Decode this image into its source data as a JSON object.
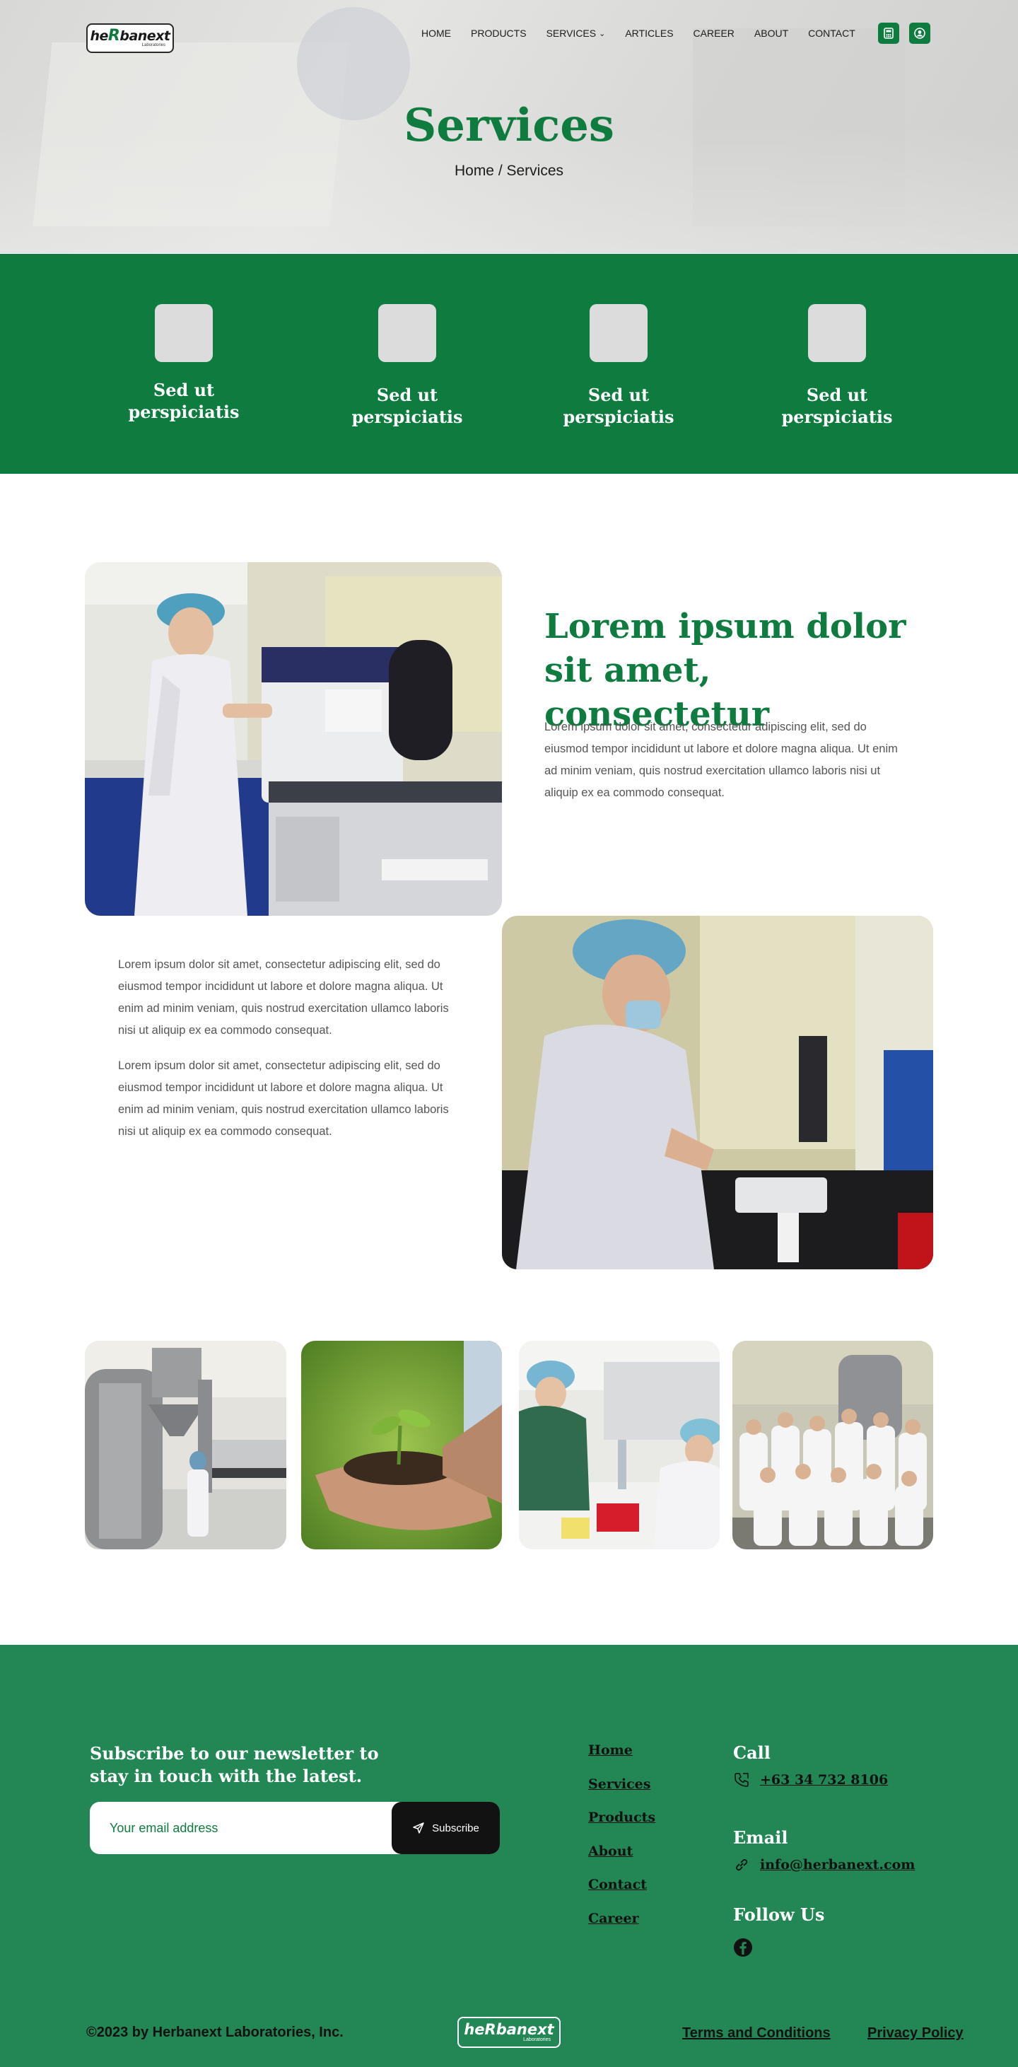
{
  "header": {
    "logo": {
      "text_pre": "he",
      "text_r": "R",
      "text_post": "banext",
      "sub": "Laboratories"
    },
    "nav": [
      {
        "label": "HOME"
      },
      {
        "label": "PRODUCTS"
      },
      {
        "label": "SERVICES"
      },
      {
        "label": "ARTICLES"
      },
      {
        "label": "CAREER"
      },
      {
        "label": "ABOUT"
      },
      {
        "label": "CONTACT"
      }
    ],
    "icons": {
      "calculator": "calculator-icon",
      "user": "user-circle-icon"
    }
  },
  "hero": {
    "title": "Services",
    "breadcrumb": "Home / Services"
  },
  "features": [
    {
      "label": "Sed ut perspiciatis"
    },
    {
      "label": "Sed ut perspiciatis"
    },
    {
      "label": "Sed ut perspiciatis"
    },
    {
      "label": "Sed ut perspiciatis"
    }
  ],
  "content": {
    "heading": "Lorem ipsum dolor sit amet, consectetur",
    "paragraph_right": "Lorem ipsum dolor sit amet, consectetur adipiscing elit, sed do eiusmod tempor incididunt ut labore et dolore magna aliqua. Ut enim ad minim veniam, quis nostrud exercitation ullamco laboris nisi ut aliquip ex ea commodo consequat.",
    "paragraph_left_1": "Lorem ipsum dolor sit amet, consectetur adipiscing elit, sed do eiusmod tempor incididunt ut labore et dolore magna aliqua. Ut enim ad minim veniam, quis nostrud exercitation ullamco laboris nisi ut aliquip ex ea commodo consequat.",
    "paragraph_left_2": "Lorem ipsum dolor sit amet, consectetur adipiscing elit, sed do eiusmod tempor incididunt ut labore et dolore magna aliqua. Ut enim ad minim veniam, quis nostrud exercitation ullamco laboris nisi ut aliquip ex ea commodo consequat."
  },
  "footer": {
    "newsletter_title": "Subscribe to our newsletter to stay in touch with the latest.",
    "email_placeholder": "Your email address",
    "subscribe_label": "Subscribe",
    "links": [
      {
        "label": "Home"
      },
      {
        "label": "Services"
      },
      {
        "label": "Products"
      },
      {
        "label": "About"
      },
      {
        "label": "Contact"
      },
      {
        "label": "Career"
      }
    ],
    "call_title": "Call",
    "phone": "+63 34 732 8106",
    "email_title": "Email",
    "email": "info@herbanext.com",
    "follow_title": "Follow Us",
    "copyright": "©2023 by Herbanext Laboratories, Inc.",
    "logo": {
      "text": "heRbanext",
      "sub": "Laboratories"
    },
    "terms": "Terms and Conditions",
    "privacy": "Privacy Policy"
  },
  "colors": {
    "brand_green": "#0e7c3f",
    "footer_green": "#228754",
    "dark": "#121212"
  }
}
